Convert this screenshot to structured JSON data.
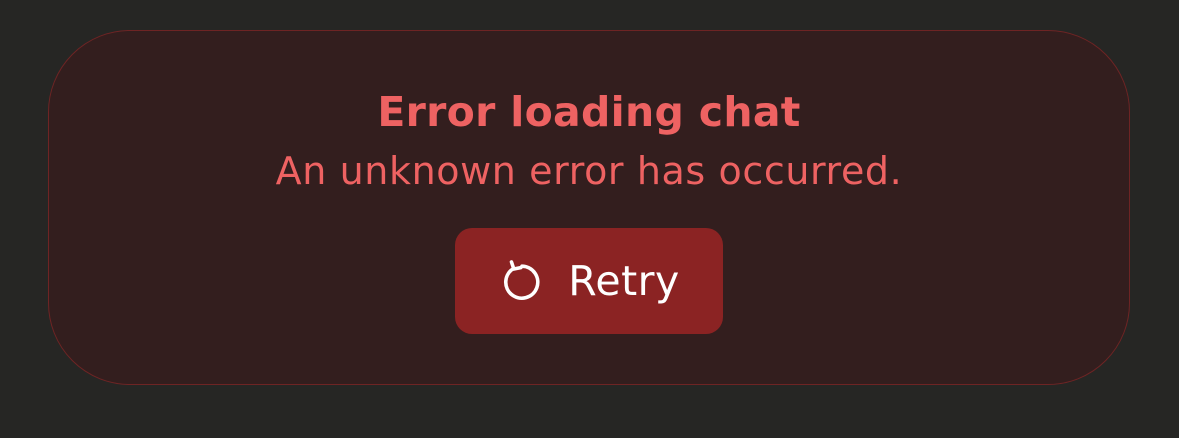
{
  "error": {
    "title": "Error loading chat",
    "message": "An unknown error has occurred.",
    "retry_label": "Retry",
    "retry_icon": "retry-icon"
  },
  "colors": {
    "page_background": "#262624",
    "card_background": "#331e1e",
    "card_border": "#6e2424",
    "error_text": "#ee6262",
    "button_background": "#8b2323",
    "button_text": "#ffffff"
  }
}
